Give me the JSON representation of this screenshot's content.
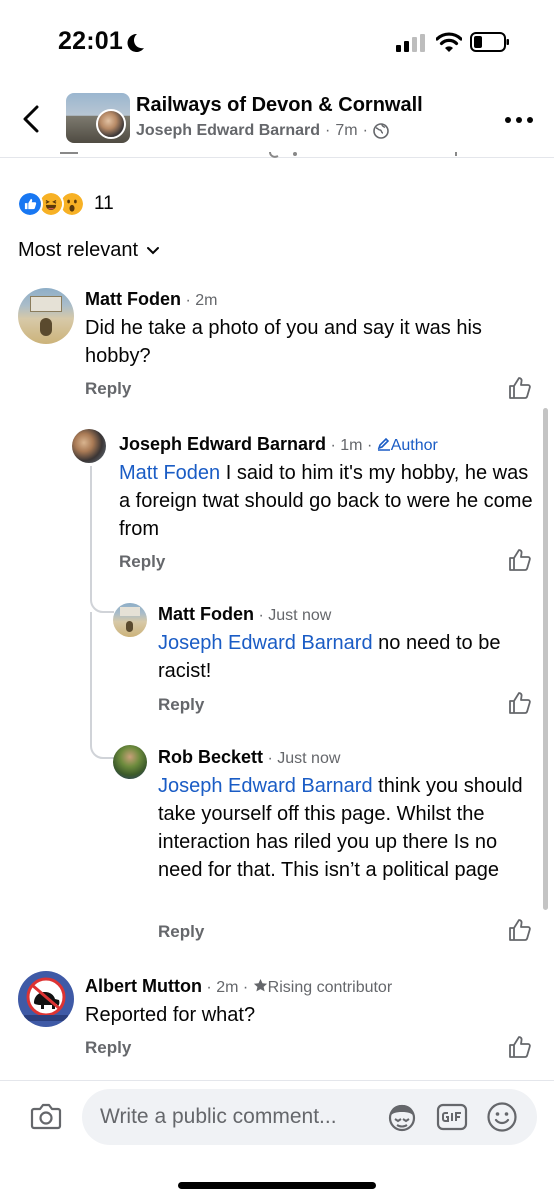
{
  "status_bar": {
    "time": "22:01"
  },
  "header": {
    "group_name": "Railways of Devon & Cornwall",
    "author": "Joseph Edward Barnard",
    "time": "7m",
    "separator": "·"
  },
  "reactions": {
    "count": "11",
    "types": [
      "like",
      "haha",
      "wow"
    ]
  },
  "sort": {
    "label": "Most relevant"
  },
  "comments": [
    {
      "name": "Matt Foden",
      "time": "2m",
      "text": "Did he take a photo of you and say it was his hobby?",
      "reply": "Reply"
    },
    {
      "name": "Joseph Edward Barnard",
      "time": "1m",
      "badge": "Author",
      "mention": "Matt Foden",
      "text": " I said to him it's my hobby, he was a foreign twat should go back to were he come from",
      "reply": "Reply"
    },
    {
      "name": "Matt Foden",
      "time": "Just now",
      "mention": "Joseph Edward Barnard",
      "text": " no need to be racist!",
      "reply": "Reply"
    },
    {
      "name": "Rob Beckett",
      "time": "Just now",
      "mention": "Joseph Edward Barnard",
      "text": " think you should take yourself off this page. Whilst the interaction has riled you up there Is no need for that. This isn’t a political page",
      "reply": "Reply"
    },
    {
      "name": "Albert Mutton",
      "time": "2m",
      "badge": "Rising contributor",
      "text": "Reported for what?",
      "reply": "Reply"
    }
  ],
  "composer": {
    "placeholder": "Write a public comment..."
  },
  "colors": {
    "link": "#1a5cc5",
    "secondary_text": "#65676b",
    "like_blue": "#1877f2"
  },
  "icons": [
    "moon-icon",
    "signal-icon",
    "wifi-icon",
    "battery-icon",
    "back-icon",
    "globe-icon",
    "more-icon",
    "chevron-down-icon",
    "like-icon",
    "pencil-icon",
    "star-icon",
    "camera-icon",
    "avatar-sticker-icon",
    "gif-icon",
    "emoji-icon"
  ]
}
